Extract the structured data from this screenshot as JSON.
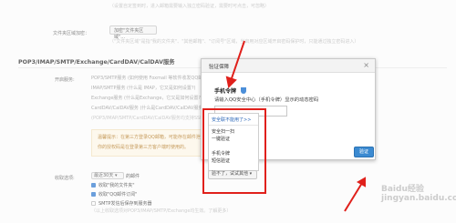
{
  "top_faint_line": "（设置自定签到时，进入邮箱需要输入独立密码验证，需要时可点击，可忽略）",
  "attachments": {
    "label": "文件夹区域加密：",
    "button": "加密\"文件夹区域\"...",
    "note": "（\"文件夹区域\"是指\"我的文件夹\"、\"其他邮箱\"、\"订阅号\"区域，当启用对应区域开启密码保护时，只能通过独立密码进入）"
  },
  "section_title": "POP3/IMAP/SMTP/Exchange/CardDAV/CalDAV服务",
  "services": {
    "label": "开启服务:",
    "items": [
      "POP3/SMTP服务 (如何使用 Foxmail 等软件收发QQ邮件?)",
      "IMAP/SMTP服务 (什么是 IMAP，它又是如何设置?)",
      "Exchange服务 (什么是Exchange，它又是如何设置?)",
      "CardDAV/CalDAV服务 (什么是CardDAV/CalDAV服务?)",
      "(POP3/IMAP/SMTP/CardDAV/CalDAV服务均支持SSL连接，如何设置?)"
    ],
    "tip": "温馨提示：在第三方登录QQ邮箱，可能存在邮件泄露风险，甚至危害Apple ID安全。请使用独立密码或授权码登录第三方客户端。",
    "tip2": "你的授权码是在登录第三方客户端时使用的。"
  },
  "receive": {
    "label": "收取选项:",
    "select_value": "最近30天",
    "select_suffix": "的邮件",
    "options": [
      "收取\"我的文件夹\"",
      "收取\"QQ邮件订阅\"",
      "SMTP发信后保存到服务器"
    ],
    "note": "（以上收取选项对POP3/IMAP/SMTP/Exchange均生效。了解更多）"
  },
  "dialog": {
    "title": "验证保障",
    "close": "×",
    "heading": "手机令牌",
    "subtitle": "请输入QQ安全中心（手机令牌）显示的动态密码",
    "code_value": "",
    "menu_items": [
      "安全扫一扫",
      "一键验证",
      "手机令牌",
      "短信验证"
    ],
    "menu_header": "安全联不能用了>>",
    "switch_button": "验不了，试试其他",
    "confirm_button": "验证"
  },
  "colors": {
    "accent": "#3b8ad1",
    "annotation_red": "#e0201b",
    "tip_bg": "#fdf6e7"
  },
  "watermark": "Baidu经验 jingyan.baidu.com"
}
